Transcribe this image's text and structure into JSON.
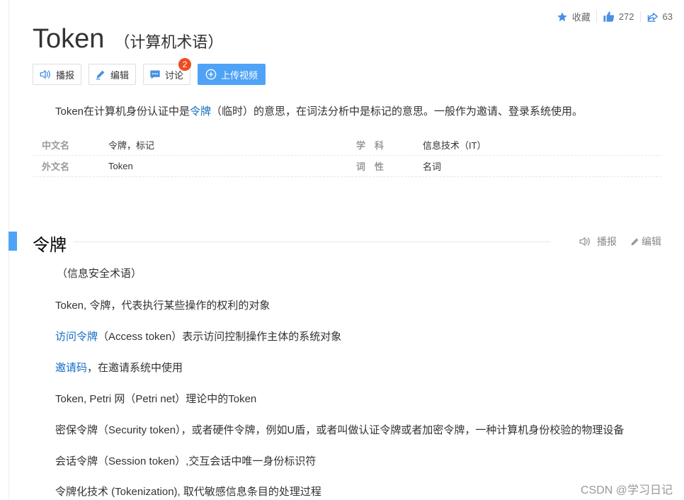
{
  "stats": {
    "collect_label": "收藏",
    "like_count": "272",
    "share_count": "63"
  },
  "title": {
    "main": "Token",
    "sub": "（计算机术语）"
  },
  "toolbar": {
    "broadcast_label": "播报",
    "edit_label": "编辑",
    "discuss_label": "讨论",
    "discuss_badge": "2",
    "upload_label": "上传视频"
  },
  "summary": {
    "prefix": "Token在计算机身份认证中是",
    "link": "令牌",
    "suffix": "（临时）的意思，在词法分析中是标记的意思。一般作为邀请、登录系统使用。"
  },
  "basic_info": [
    {
      "k1": "中文名",
      "v1": "令牌，标记",
      "k2": "学　科",
      "v2": "信息技术（IT）"
    },
    {
      "k1": "外文名",
      "v1": "Token",
      "k2": "词　性",
      "v2": "名词"
    }
  ],
  "section": {
    "title": "令牌",
    "broadcast_label": "播报",
    "edit_label": "编辑"
  },
  "paragraphs": {
    "p0": "（信息安全术语）",
    "p1": "Token, 令牌，代表执行某些操作的权利的对象",
    "p2_link": "访问令牌",
    "p2_rest": "（Access token）表示访问控制操作主体的系统对象",
    "p3_link": "邀请码",
    "p3_rest": "，在邀请系统中使用",
    "p4": "Token, Petri 网（Petri net）理论中的Token",
    "p5": "密保令牌（Security token），或者硬件令牌，例如U盾，或者叫做认证令牌或者加密令牌，一种计算机身份校验的物理设备",
    "p6": "会话令牌（Session token）,交互会话中唯一身份标识符",
    "p7": "令牌化技术 (Tokenization), 取代敏感信息条目的处理过程"
  },
  "watermark": "CSDN @学习日记",
  "colors": {
    "accent": "#4fa3f7",
    "link": "#136ec2",
    "badge": "#f04b1f"
  }
}
